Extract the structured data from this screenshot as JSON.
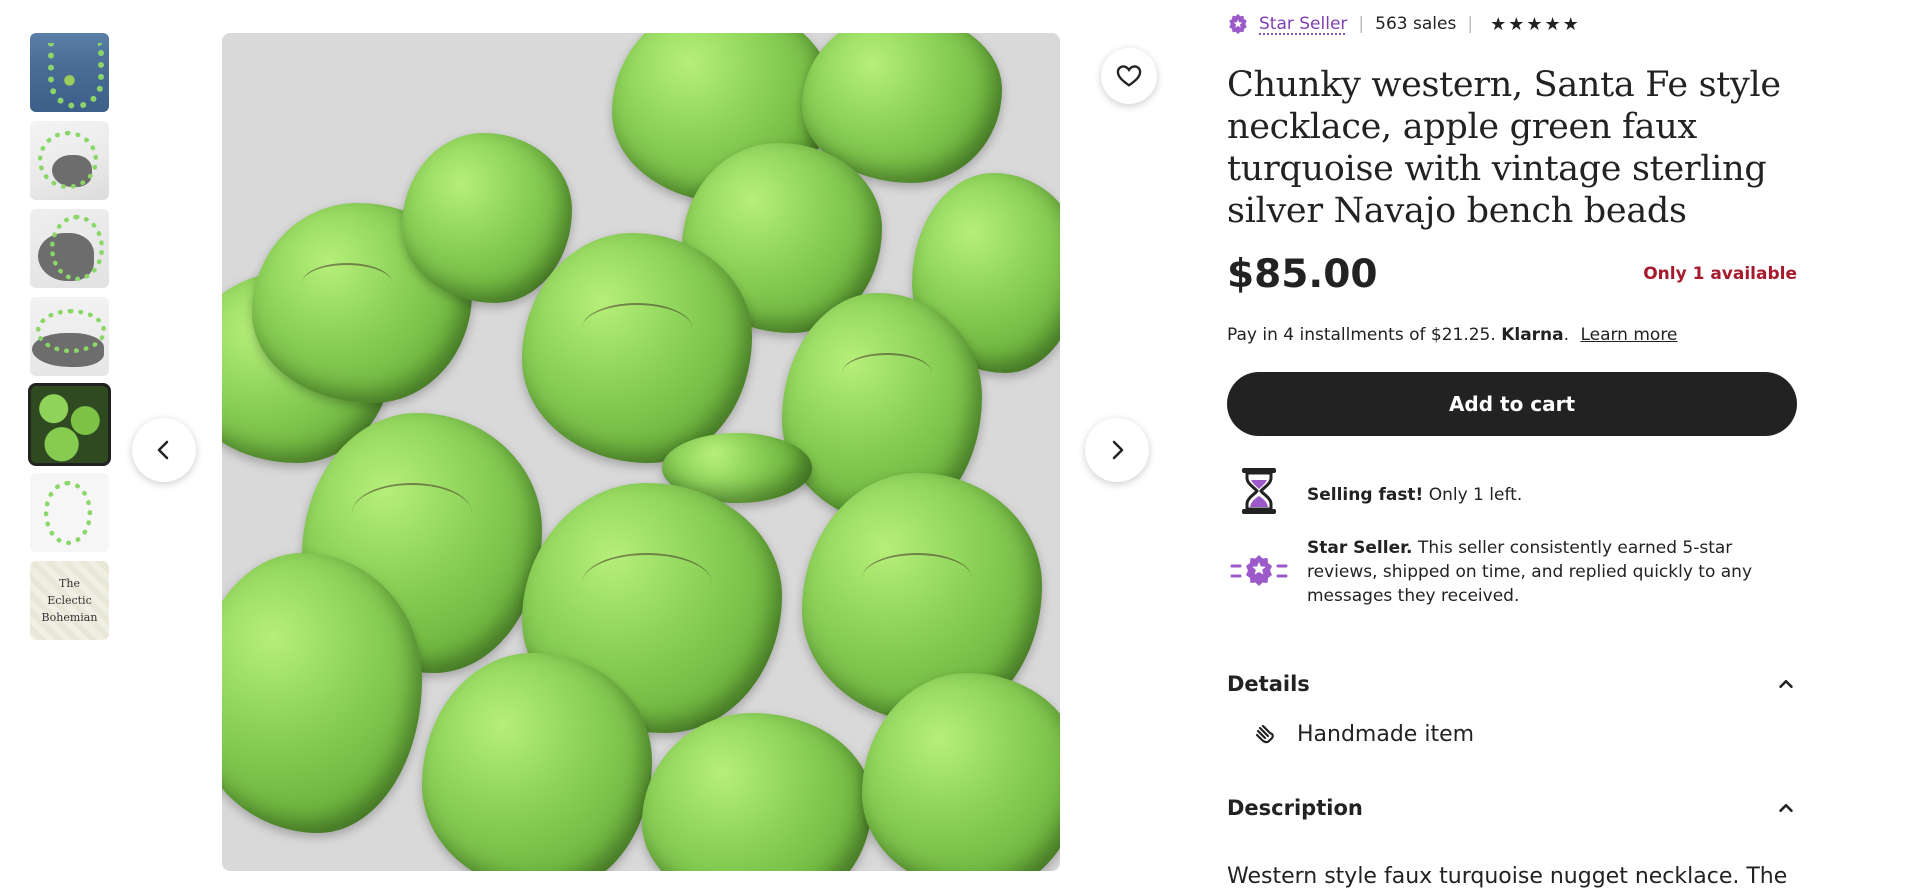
{
  "gallery": {
    "thumbnail_count": 7,
    "active_index": 4,
    "logo_text": [
      "The",
      "Eclectic",
      "Bohemian"
    ]
  },
  "buttons": {
    "prev": "chevron-left-icon",
    "next": "chevron-right-icon",
    "favorite": "heart-icon"
  },
  "seller": {
    "badge_label": "Star Seller",
    "sales": "563 sales",
    "rating_stars": 5
  },
  "product": {
    "title": "Chunky western, Santa Fe style necklace, apple green faux turquoise with vintage sterling silver Navajo bench beads",
    "price": "$85.00",
    "availability": "Only 1 available",
    "klarna_text": "Pay in 4 installments of $21.25.",
    "klarna_brand": "Klarna",
    "klarna_dot": ".",
    "learn_more": "Learn more",
    "add_to_cart": "Add to cart"
  },
  "highlights": {
    "selling_fast_bold": "Selling fast!",
    "selling_fast_rest": " Only 1 left.",
    "star_seller_bold": "Star Seller.",
    "star_seller_rest": " This seller consistently earned 5-star reviews, shipped on time, and replied quickly to any messages they received."
  },
  "details": {
    "heading": "Details",
    "handmade": "Handmade item"
  },
  "description": {
    "heading": "Description",
    "text": "Western style faux turquoise nugget necklace. The"
  },
  "colors": {
    "accent_purple": "#7f3fb3",
    "availability_red": "#a61a2e",
    "button_dark": "#222222"
  }
}
